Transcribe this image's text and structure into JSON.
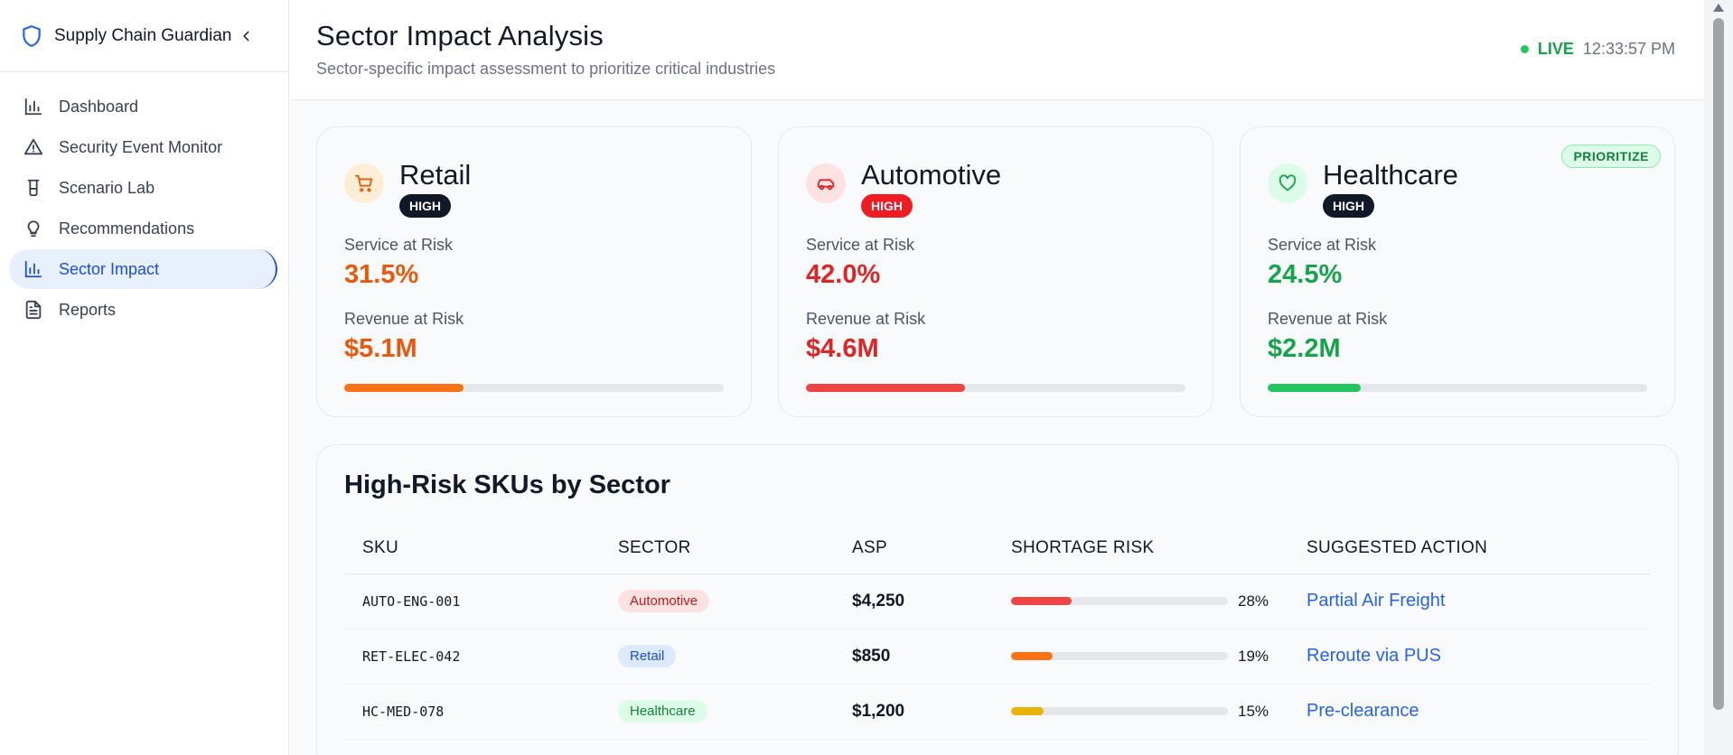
{
  "app": {
    "title": "Supply Chain Guardian"
  },
  "sidebar": {
    "items": [
      {
        "label": "Dashboard",
        "icon": "bar-chart-icon"
      },
      {
        "label": "Security Event Monitor",
        "icon": "alert-triangle-icon"
      },
      {
        "label": "Scenario Lab",
        "icon": "beaker-icon"
      },
      {
        "label": "Recommendations",
        "icon": "lightbulb-icon"
      },
      {
        "label": "Sector Impact",
        "icon": "bar-chart-icon",
        "active": true
      },
      {
        "label": "Reports",
        "icon": "document-icon"
      }
    ]
  },
  "header": {
    "title": "Sector Impact Analysis",
    "subtitle": "Sector-specific impact assessment to prioritize critical industries",
    "live_label": "LIVE",
    "time": "12:33:57 PM"
  },
  "sectors": [
    {
      "name": "Retail",
      "icon": "cart-icon",
      "severity": "HIGH",
      "service_label": "Service at Risk",
      "service_value": "31.5%",
      "revenue_label": "Revenue at Risk",
      "revenue_value": "$5.1M",
      "progress": 0.315,
      "color": "#ea580c",
      "bar_color": "#f97316",
      "icon_bg": "#ffedd5",
      "severity_bg": "#111827",
      "prioritize": ""
    },
    {
      "name": "Automotive",
      "icon": "car-icon",
      "severity": "HIGH",
      "service_label": "Service at Risk",
      "service_value": "42.0%",
      "revenue_label": "Revenue at Risk",
      "revenue_value": "$4.6M",
      "progress": 0.42,
      "color": "#dc2626",
      "bar_color": "#ef4444",
      "icon_bg": "#fee2e2",
      "severity_bg": "#ef1c24",
      "prioritize": ""
    },
    {
      "name": "Healthcare",
      "icon": "heart-icon",
      "severity": "HIGH",
      "service_label": "Service at Risk",
      "service_value": "24.5%",
      "revenue_label": "Revenue at Risk",
      "revenue_value": "$2.2M",
      "progress": 0.245,
      "color": "#16a34a",
      "bar_color": "#22c55e",
      "icon_bg": "#dcfce7",
      "severity_bg": "#111827",
      "prioritize": "PRIORITIZE"
    }
  ],
  "skus": {
    "title": "High-Risk SKUs by Sector",
    "columns": [
      "SKU",
      "SECTOR",
      "ASP",
      "SHORTAGE RISK",
      "SUGGESTED ACTION"
    ],
    "rows": [
      {
        "sku": "AUTO-ENG-001",
        "sector": "Automotive",
        "asp": "$4,250",
        "risk": 28,
        "risk_label": "28%",
        "action": "Partial Air Freight",
        "badge_bg": "#fee2e2",
        "badge_fg": "#b91c1c",
        "bar_color": "#ef4444"
      },
      {
        "sku": "RET-ELEC-042",
        "sector": "Retail",
        "asp": "$850",
        "risk": 19,
        "risk_label": "19%",
        "action": "Reroute via PUS",
        "badge_bg": "#dbeafe",
        "badge_fg": "#1d4ed8",
        "bar_color": "#f97316"
      },
      {
        "sku": "HC-MED-078",
        "sector": "Healthcare",
        "asp": "$1,200",
        "risk": 15,
        "risk_label": "15%",
        "action": "Pre-clearance",
        "badge_bg": "#dcfce7",
        "badge_fg": "#15803d",
        "bar_color": "#eab308"
      }
    ]
  }
}
